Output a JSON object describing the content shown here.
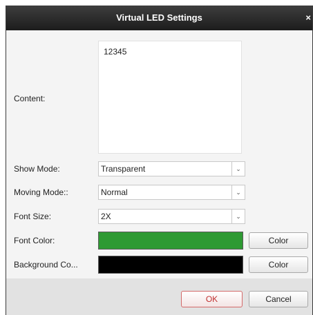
{
  "dialog": {
    "title": "Virtual LED Settings",
    "close_glyph": "×"
  },
  "content": {
    "label": "Content:",
    "value": "12345"
  },
  "show_mode": {
    "label": "Show Mode:",
    "value": "Transparent"
  },
  "moving_mode": {
    "label": "Moving Mode::",
    "value": "Normal"
  },
  "font_size": {
    "label": "Font Size:",
    "value": "2X"
  },
  "font_color": {
    "label": "Font Color:",
    "color": "#2e9a33",
    "button": "Color"
  },
  "background_color": {
    "label": "Background Co...",
    "color": "#000000",
    "button": "Color"
  },
  "footer": {
    "ok": "OK",
    "cancel": "Cancel"
  },
  "icons": {
    "dropdown": "chevron-down-icon",
    "close": "close-icon"
  }
}
